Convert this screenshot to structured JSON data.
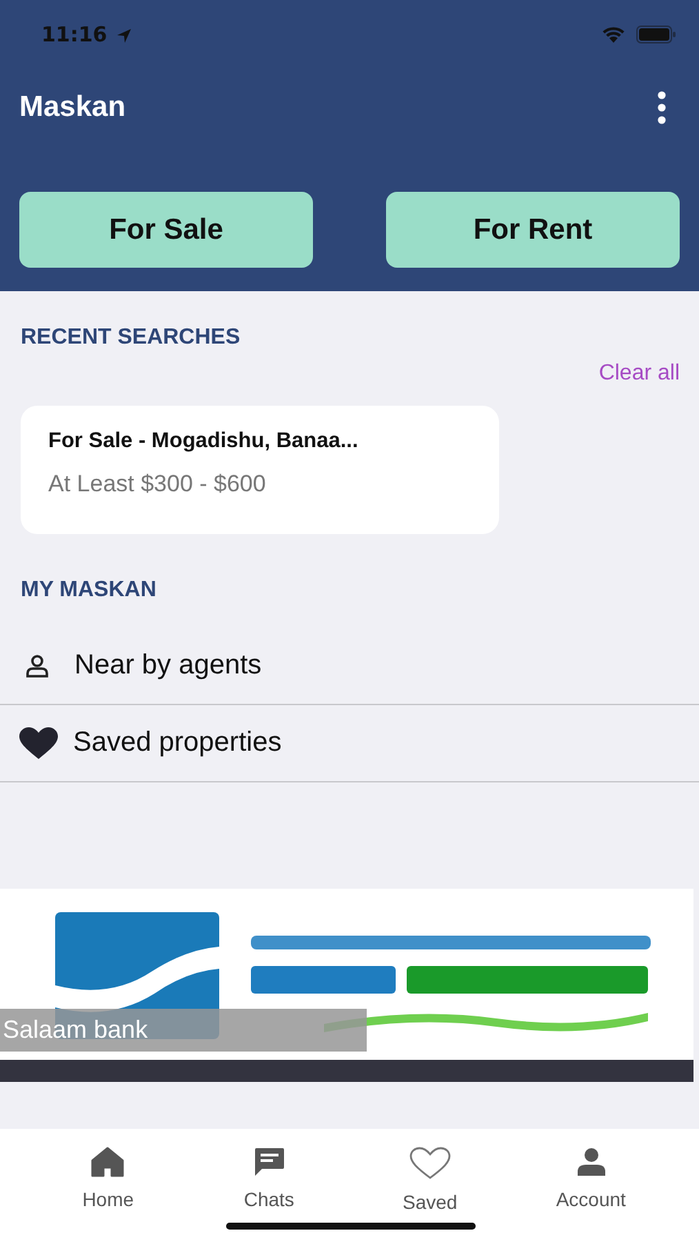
{
  "status_bar": {
    "time": "11:16"
  },
  "app_bar": {
    "title": "Maskan"
  },
  "mode_buttons": [
    "For Sale",
    "For Rent"
  ],
  "recent_searches": {
    "heading": "RECENT SEARCHES",
    "clear_label": "Clear all",
    "items": [
      {
        "title": "For Sale - Mogadishu, Banaa...",
        "subtitle": "At Least $300 - $600"
      }
    ]
  },
  "my_maskan": {
    "heading": "MY MASKAN",
    "items": [
      {
        "kind": "agents",
        "label": "Near by agents"
      },
      {
        "kind": "saved",
        "label": "Saved properties"
      }
    ]
  },
  "banner": {
    "kind": "picture",
    "caption": "Salaam bank"
  },
  "tab_bar": [
    {
      "kind": "home",
      "label": "Home"
    },
    {
      "kind": "chats",
      "label": "Chats"
    },
    {
      "kind": "saved",
      "label": "Saved"
    },
    {
      "kind": "account",
      "label": "Account"
    }
  ]
}
